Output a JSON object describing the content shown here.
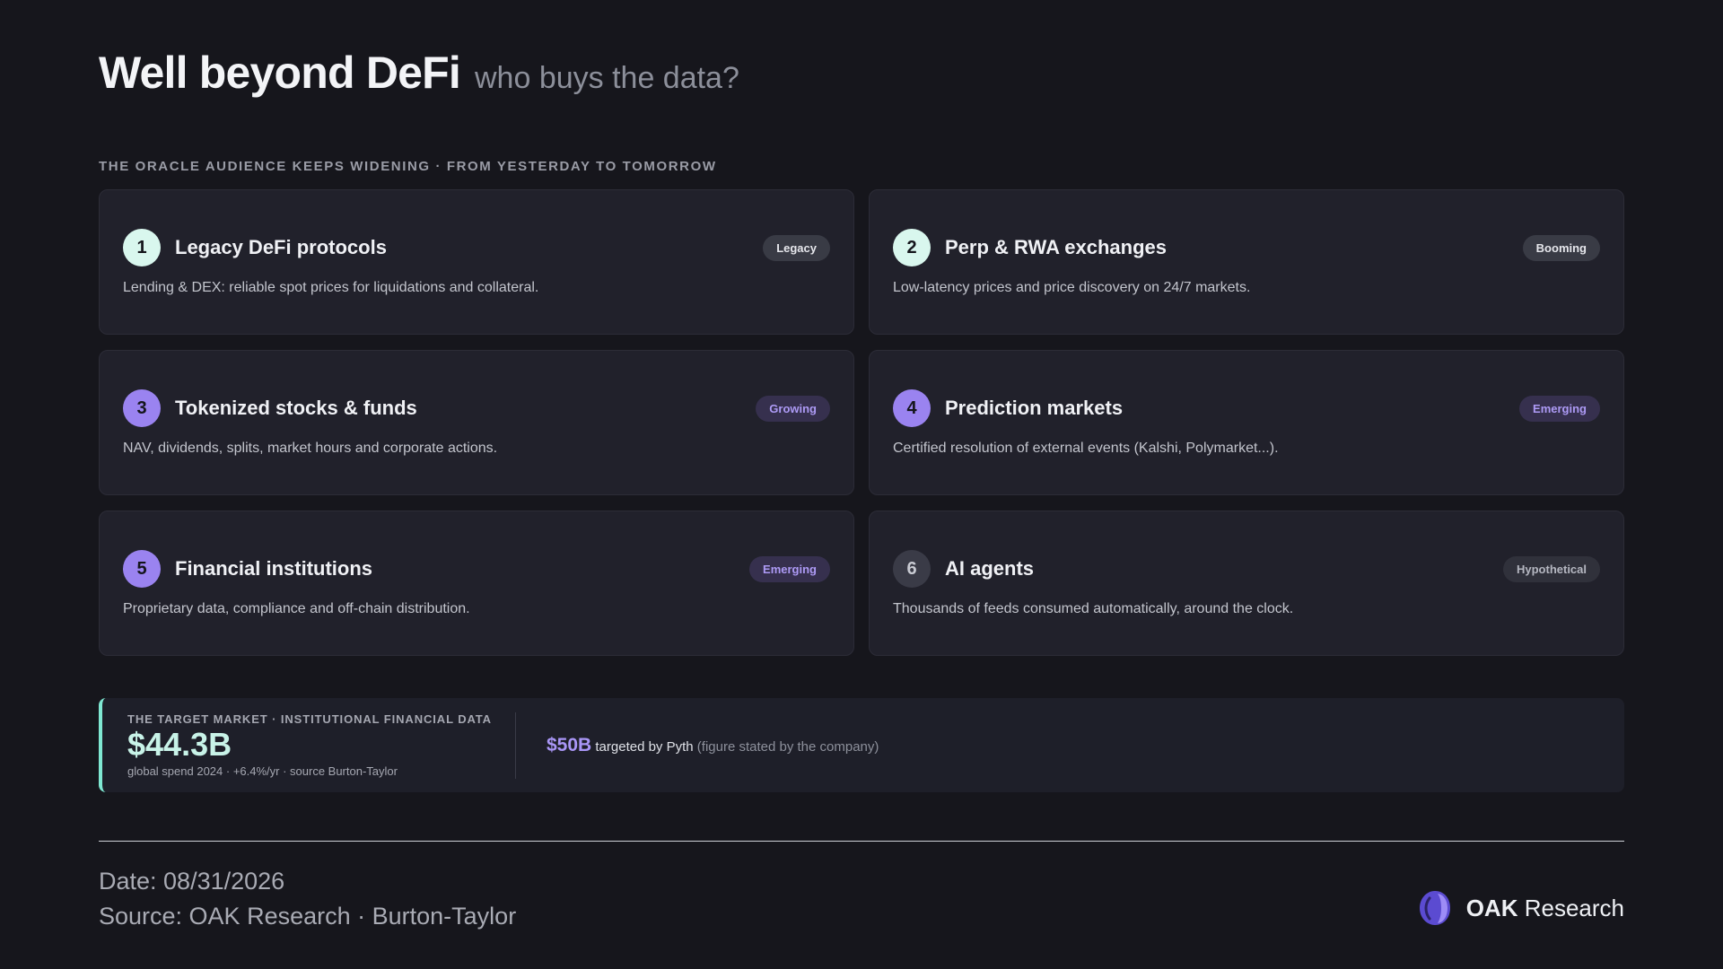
{
  "header": {
    "title": "Well beyond DeFi",
    "subtitle": "who buys the data?"
  },
  "kicker": "THE ORACLE AUDIENCE KEEPS WIDENING · FROM YESTERDAY TO TOMORROW",
  "cards": [
    {
      "number": "1",
      "title": "Legacy DeFi protocols",
      "badge": "Legacy",
      "description": "Lending & DEX: reliable spot prices for liquidations and collateral."
    },
    {
      "number": "2",
      "title": "Perp & RWA exchanges",
      "badge": "Booming",
      "description": "Low-latency prices and price discovery on 24/7 markets."
    },
    {
      "number": "3",
      "title": "Tokenized stocks & funds",
      "badge": "Growing",
      "description": "NAV, dividends, splits, market hours and corporate actions."
    },
    {
      "number": "4",
      "title": "Prediction markets",
      "badge": "Emerging",
      "description": "Certified resolution of external events (Kalshi, Polymarket...)."
    },
    {
      "number": "5",
      "title": "Financial institutions",
      "badge": "Emerging",
      "description": "Proprietary data, compliance and off-chain distribution."
    },
    {
      "number": "6",
      "title": "AI agents",
      "badge": "Hypothetical",
      "description": "Thousands of feeds consumed automatically, around the clock."
    }
  ],
  "market": {
    "kicker": "THE TARGET MARKET · INSTITUTIONAL FINANCIAL DATA",
    "value": "$44.3B",
    "note": "global spend 2024 · +6.4%/yr · source Burton-Taylor",
    "pyth_value": "$50B",
    "pyth_text": "targeted by Pyth",
    "pyth_note": "(figure stated by the company)"
  },
  "footer": {
    "date": "Date: 08/31/2026",
    "source": "Source: OAK Research · Burton-Taylor",
    "logo_bold": "OAK",
    "logo_rest": "Research"
  },
  "colors": {
    "background": "#16161c",
    "card": "#21212b",
    "mint": "#d9f7ee",
    "violet": "#9a83f0",
    "accent_bar": "#7fe8d2",
    "pyth": "#a996f6"
  }
}
